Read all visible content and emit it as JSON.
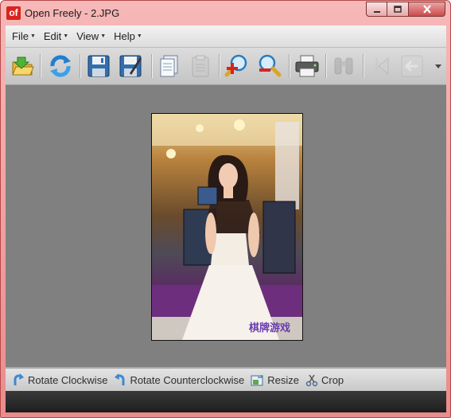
{
  "window": {
    "app_icon_text": "of",
    "title": "Open Freely - 2.JPG"
  },
  "menu": {
    "items": [
      {
        "label": "File"
      },
      {
        "label": "Edit"
      },
      {
        "label": "View"
      },
      {
        "label": "Help"
      }
    ]
  },
  "toolbar": {
    "buttons": [
      {
        "icon": "open-folder-icon",
        "enabled": true
      },
      {
        "icon": "refresh-icon",
        "enabled": true
      },
      {
        "icon": "save-icon",
        "enabled": true
      },
      {
        "icon": "save-as-icon",
        "enabled": true
      },
      {
        "icon": "copy-icon",
        "enabled": true
      },
      {
        "icon": "paste-icon",
        "enabled": false
      },
      {
        "icon": "zoom-in-icon",
        "enabled": true
      },
      {
        "icon": "zoom-out-icon",
        "enabled": true
      },
      {
        "icon": "print-icon",
        "enabled": true
      },
      {
        "icon": "binoculars-icon",
        "enabled": false
      },
      {
        "icon": "first-page-icon",
        "enabled": false
      },
      {
        "icon": "back-arrow-icon",
        "enabled": false
      },
      {
        "icon": "overflow-chevron-icon",
        "enabled": true
      }
    ]
  },
  "image": {
    "watermark": "棋牌游戏"
  },
  "actions": {
    "rotate_cw": "Rotate Clockwise",
    "rotate_ccw": "Rotate Counterclockwise",
    "resize": "Resize",
    "crop": "Crop"
  },
  "colors": {
    "window_frame": "#e98c8c",
    "canvas_bg": "#808080",
    "close_button": "#cc4b4b",
    "app_icon": "#d7251d"
  }
}
